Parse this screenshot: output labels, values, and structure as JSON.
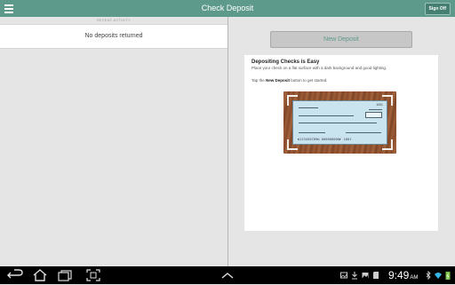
{
  "header": {
    "title": "Check Deposit",
    "sign_off_label": "Sign Off"
  },
  "left_panel": {
    "section_label": "RECENT ACTIVITY",
    "empty_message": "No deposits returned"
  },
  "right_panel": {
    "new_deposit_label": "New Deposit",
    "info_card": {
      "title": "Depositing Checks is Easy",
      "line1": "Place your check on a flat surface with a dark background and good lighting.",
      "line2_prefix": "Tap the ",
      "line2_bold": "New Deposit",
      "line2_suffix": " button to get started."
    },
    "check_illustration": {
      "check_number": "1001",
      "micr_line": "⑆123456789⑆ 000000000⑈ 1001"
    }
  },
  "system_bar": {
    "time": "9:49",
    "time_suffix": "AM"
  },
  "colors": {
    "header_teal": "#5e9a8b",
    "button_text": "#5e9a8b",
    "sysbar": "#000000"
  }
}
